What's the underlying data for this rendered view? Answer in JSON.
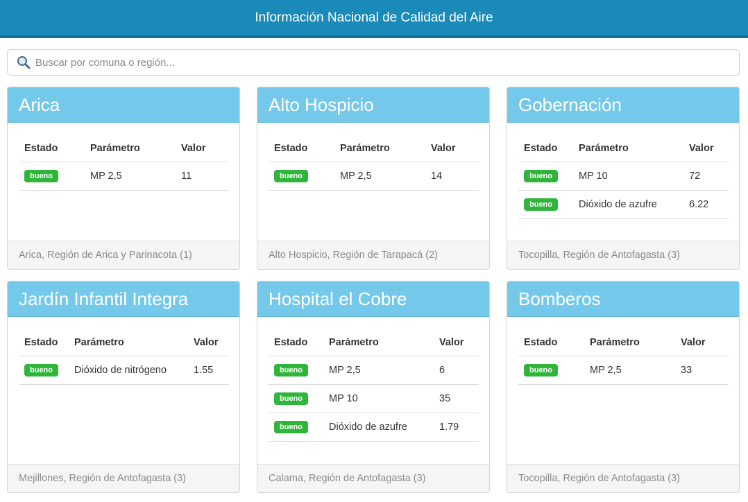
{
  "header": {
    "title": "Información Nacional de Calidad del Aire"
  },
  "search": {
    "placeholder": "Buscar por comuna o región...",
    "icon": "search-icon"
  },
  "columns": {
    "estado": "Estado",
    "parametro": "Parámetro",
    "valor": "Valor"
  },
  "colors": {
    "header": "#1a8ab8",
    "card_header": "#74c9ea",
    "status_good": "#2fb53a"
  },
  "stations": [
    {
      "name": "Arica",
      "rows": [
        {
          "status": "bueno",
          "parameter": "MP 2,5",
          "value": "11"
        }
      ],
      "location": "Arica, Región de Arica y Parinacota (1)"
    },
    {
      "name": "Alto Hospicio",
      "rows": [
        {
          "status": "bueno",
          "parameter": "MP 2,5",
          "value": "14"
        }
      ],
      "location": "Alto Hospicio, Región de Tarapacá (2)"
    },
    {
      "name": "Gobernación",
      "rows": [
        {
          "status": "bueno",
          "parameter": "MP 10",
          "value": "72"
        },
        {
          "status": "bueno",
          "parameter": "Dióxido de azufre",
          "value": "6.22"
        }
      ],
      "location": "Tocopilla, Región de Antofagasta (3)"
    },
    {
      "name": "Jardín Infantil Integra",
      "rows": [
        {
          "status": "bueno",
          "parameter": "Dióxido de nitrógeno",
          "value": "1.55"
        }
      ],
      "location": "Mejillones, Región de Antofagasta (3)"
    },
    {
      "name": "Hospital el Cobre",
      "rows": [
        {
          "status": "bueno",
          "parameter": "MP 2,5",
          "value": "6"
        },
        {
          "status": "bueno",
          "parameter": "MP 10",
          "value": "35"
        },
        {
          "status": "bueno",
          "parameter": "Dióxido de azufre",
          "value": "1.79"
        }
      ],
      "location": "Calama, Región de Antofagasta (3)"
    },
    {
      "name": "Bomberos",
      "rows": [
        {
          "status": "bueno",
          "parameter": "MP 2,5",
          "value": "33"
        }
      ],
      "location": "Tocopilla, Región de Antofagasta (3)"
    }
  ]
}
